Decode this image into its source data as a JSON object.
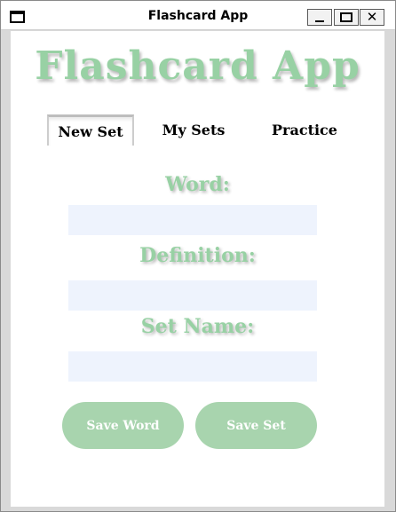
{
  "window": {
    "title": "Flashcard App",
    "close_glyph": "✕"
  },
  "app": {
    "title": "Flashcard App"
  },
  "tabs": [
    {
      "label": "New Set",
      "selected": true
    },
    {
      "label": "My Sets",
      "selected": false
    },
    {
      "label": "Practice",
      "selected": false
    }
  ],
  "form": {
    "word_label": "Word:",
    "word_value": "",
    "definition_label": "Definition:",
    "definition_value": "",
    "set_name_label": "Set Name:",
    "set_name_value": ""
  },
  "buttons": {
    "save_word": "Save Word",
    "save_set": "Save Set"
  },
  "colors": {
    "accent": "#98d1a4",
    "button": "#a8d4ae",
    "input_bg": "#eef3fd"
  },
  "icons": [
    "window-icon",
    "minimize-icon",
    "maximize-icon",
    "close-icon"
  ]
}
